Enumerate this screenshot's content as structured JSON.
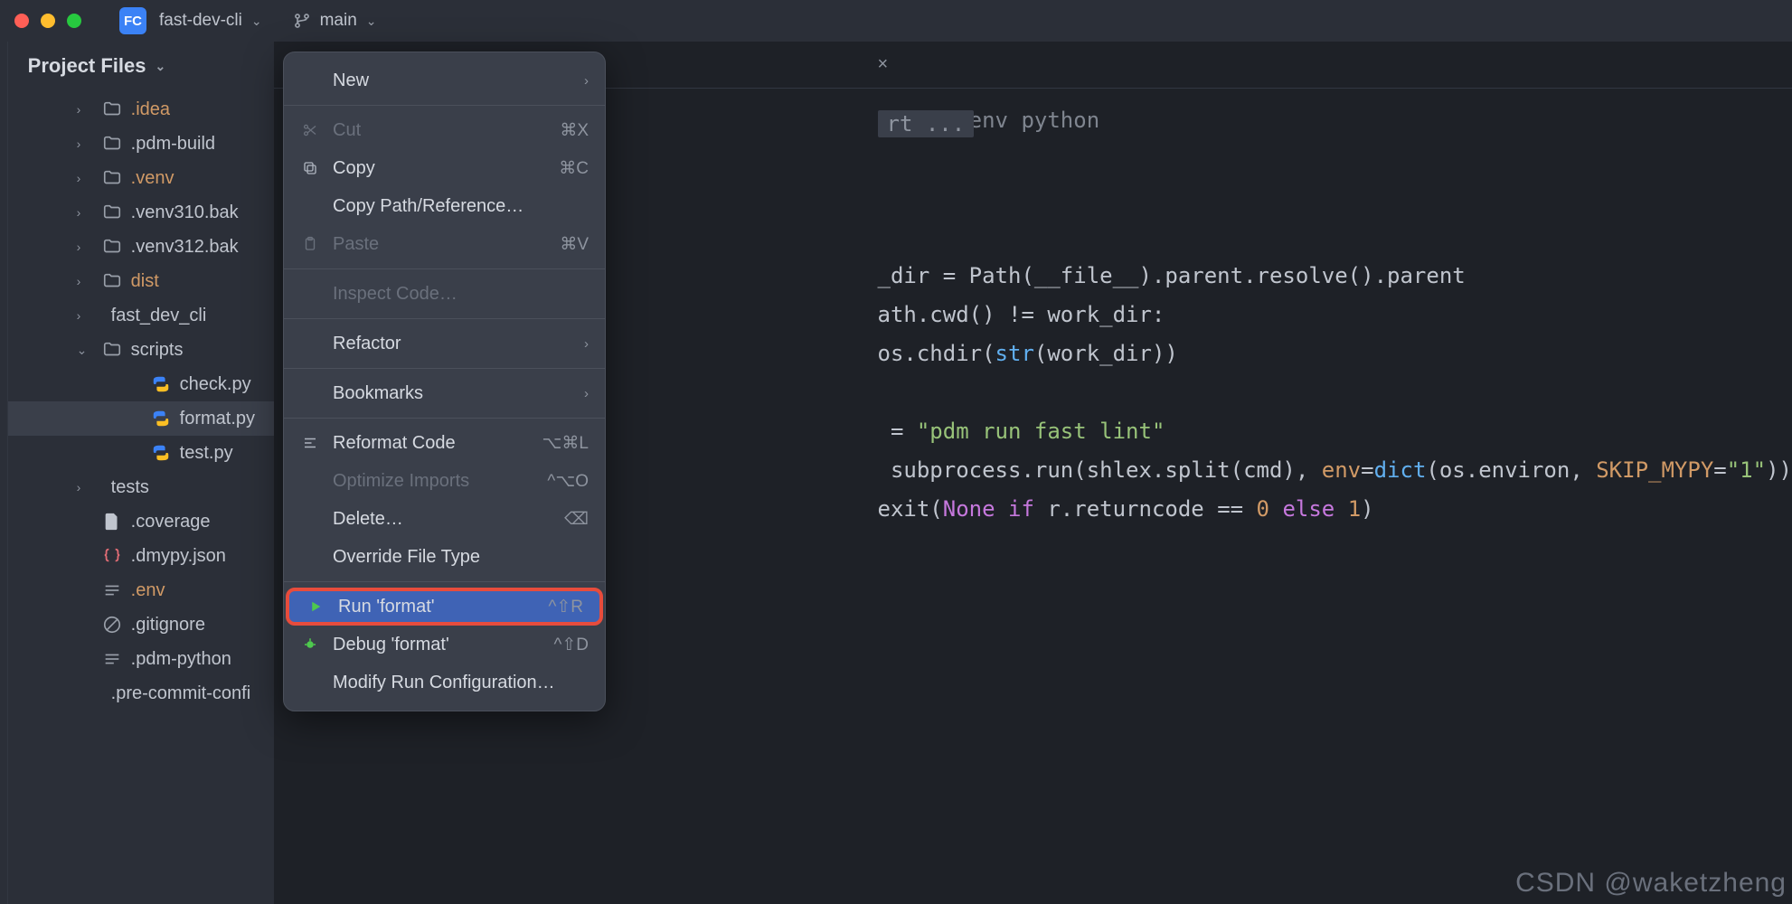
{
  "titlebar": {
    "project_badge": "FC",
    "project_name": "fast-dev-cli",
    "branch": "main"
  },
  "sidebar": {
    "title": "Project Files"
  },
  "tree": [
    {
      "label": ".idea",
      "kind": "folder",
      "chev": true,
      "depth": 1,
      "color": "orange"
    },
    {
      "label": ".pdm-build",
      "kind": "folder",
      "chev": true,
      "depth": 1
    },
    {
      "label": ".venv",
      "kind": "folder",
      "chev": true,
      "depth": 1,
      "color": "orange"
    },
    {
      "label": ".venv310.bak",
      "kind": "folder",
      "chev": true,
      "depth": 1
    },
    {
      "label": ".venv312.bak",
      "kind": "folder",
      "chev": true,
      "depth": 1
    },
    {
      "label": "dist",
      "kind": "folder",
      "chev": true,
      "depth": 1,
      "color": "orange"
    },
    {
      "label": "fast_dev_cli",
      "kind": "module",
      "chev": true,
      "depth": 1
    },
    {
      "label": "scripts",
      "kind": "folder",
      "chev": true,
      "depth": 1,
      "open": true
    },
    {
      "label": "check.py",
      "kind": "py",
      "depth": 2
    },
    {
      "label": "format.py",
      "kind": "py",
      "depth": 2,
      "selected": true
    },
    {
      "label": "test.py",
      "kind": "py",
      "depth": 2
    },
    {
      "label": "tests",
      "kind": "module",
      "chev": true,
      "depth": 1
    },
    {
      "label": ".coverage",
      "kind": "file",
      "depth": 1
    },
    {
      "label": ".dmypy.json",
      "kind": "json",
      "depth": 1
    },
    {
      "label": ".env",
      "kind": "env",
      "depth": 1,
      "color": "orange"
    },
    {
      "label": ".gitignore",
      "kind": "gitignore",
      "depth": 1
    },
    {
      "label": ".pdm-python",
      "kind": "env",
      "depth": 1
    },
    {
      "label": ".pre-commit-confi",
      "kind": "yaml",
      "depth": 1
    }
  ],
  "context_menu": [
    {
      "label": "New",
      "submenu": true
    },
    {
      "sep": true
    },
    {
      "label": "Cut",
      "icon": "scissors",
      "shortcut": "⌘X",
      "disabled": true
    },
    {
      "label": "Copy",
      "icon": "copy",
      "shortcut": "⌘C"
    },
    {
      "label": "Copy Path/Reference…"
    },
    {
      "label": "Paste",
      "icon": "paste",
      "shortcut": "⌘V",
      "disabled": true
    },
    {
      "sep": true
    },
    {
      "label": "Inspect Code…",
      "disabled": true
    },
    {
      "sep": true
    },
    {
      "label": "Refactor",
      "submenu": true
    },
    {
      "sep": true
    },
    {
      "label": "Bookmarks",
      "submenu": true
    },
    {
      "sep": true
    },
    {
      "label": "Reformat Code",
      "icon": "reformat",
      "shortcut": "⌥⌘L"
    },
    {
      "label": "Optimize Imports",
      "shortcut": "^⌥O",
      "disabled": true
    },
    {
      "label": "Delete…",
      "shortcut": "⌫"
    },
    {
      "label": "Override File Type"
    },
    {
      "sep": true
    },
    {
      "label": "Run 'format'",
      "icon": "run",
      "shortcut": "^⇧R",
      "hovered": true,
      "highlight": true
    },
    {
      "label": "Debug 'format'",
      "icon": "debug",
      "shortcut": "^⇧D"
    },
    {
      "label": "Modify Run Configuration…"
    }
  ],
  "editor": {
    "hint": "rt ...",
    "line1_comment": "sr/bin/env python",
    "code_lines": [
      "",
      "",
      "_dir = Path(__file__).parent.resolve().parent",
      "ath.cwd() != work_dir:",
      "os.chdir(str(work_dir))",
      "",
      " = \"pdm run fast lint\"",
      " subprocess.run(shlex.split(cmd), env=dict(os.environ, SKIP_MYPY=\"1\"))",
      "exit(None if r.returncode == 0 else 1)"
    ]
  },
  "watermark": "CSDN @waketzheng"
}
